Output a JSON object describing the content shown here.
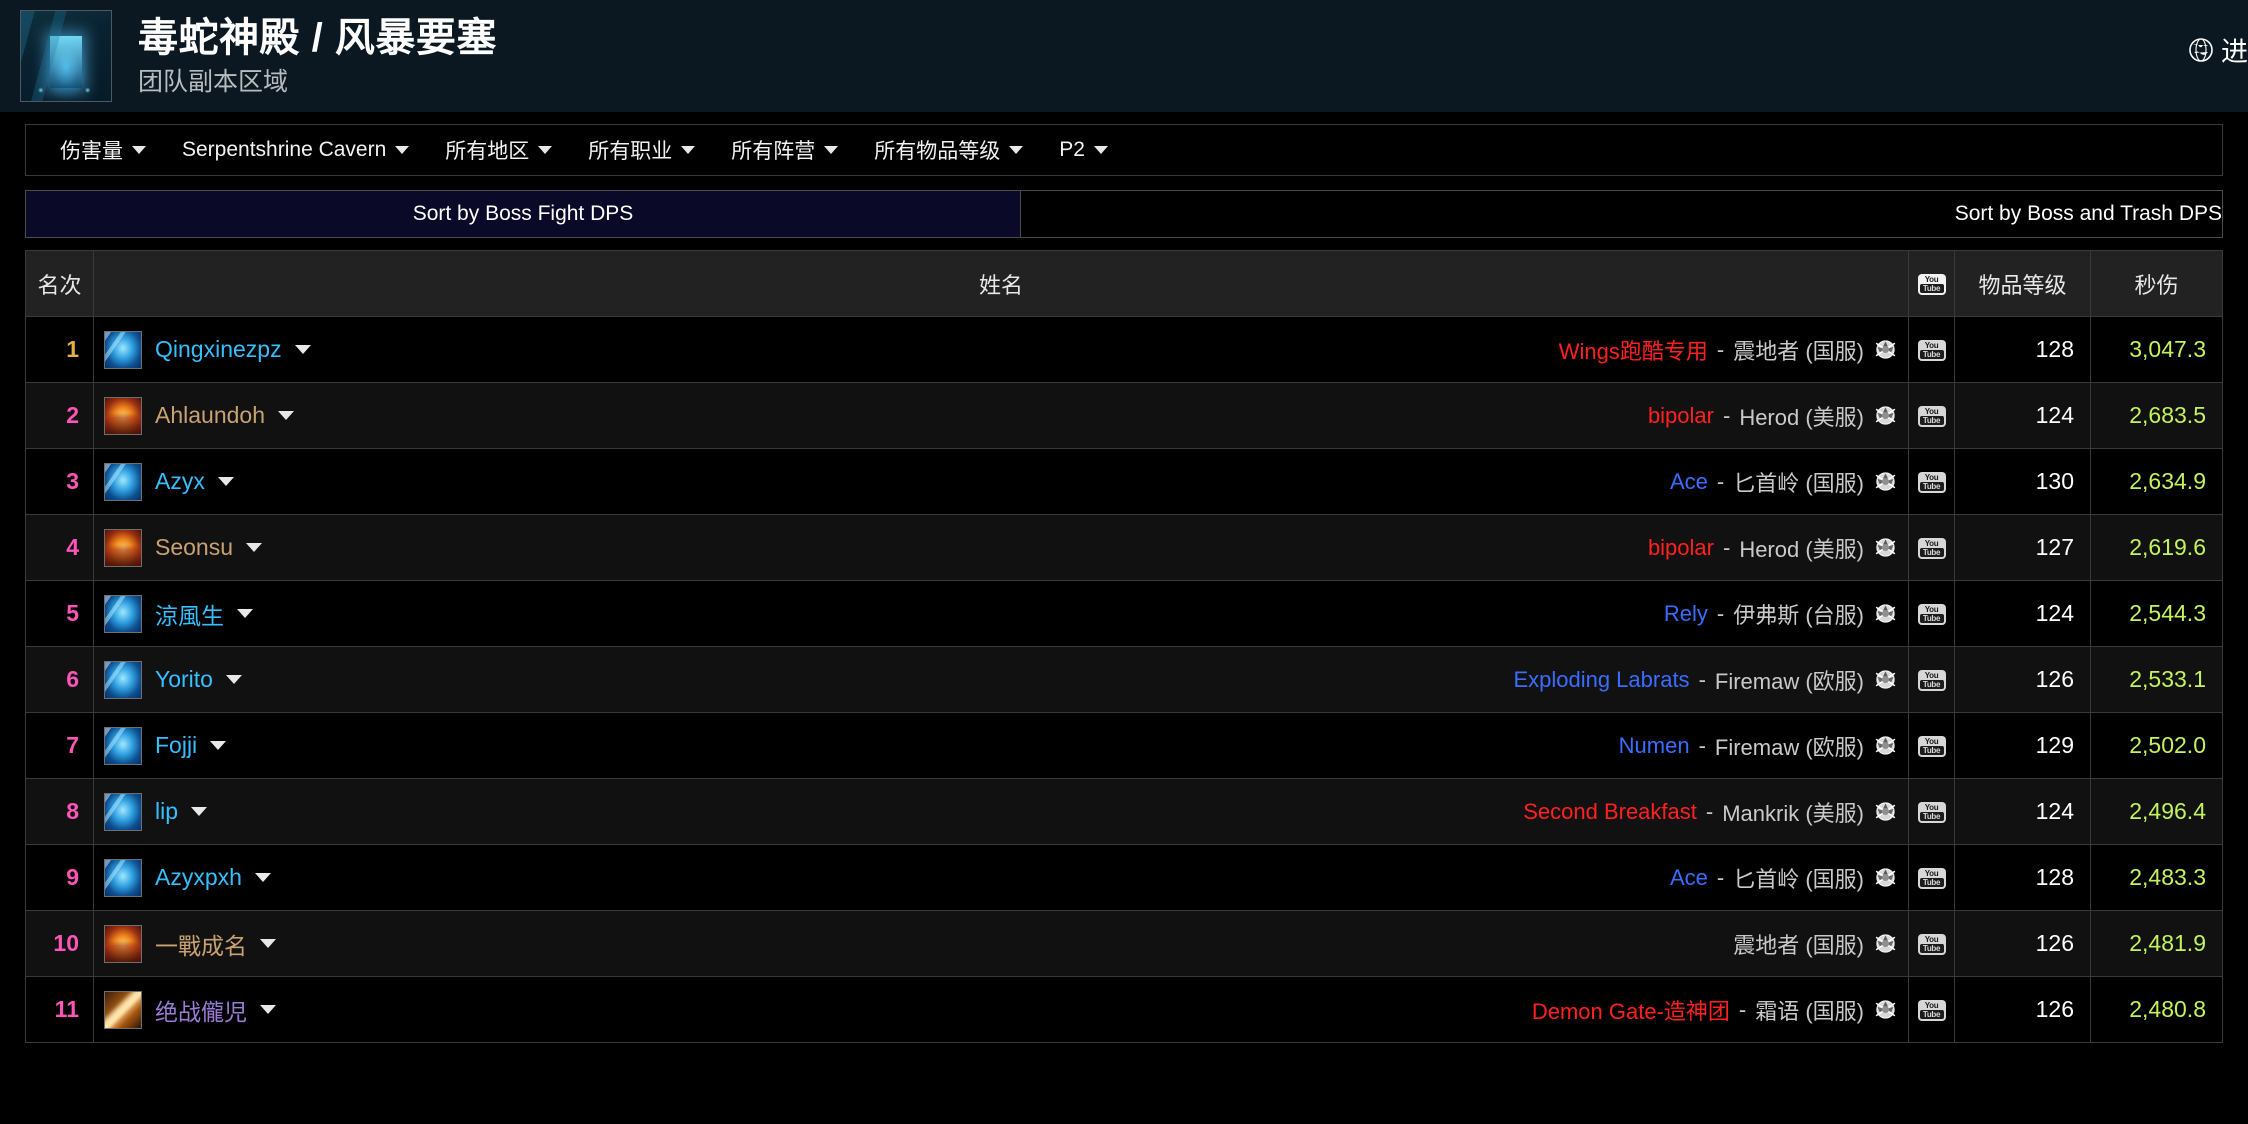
{
  "header": {
    "title": "毒蛇神殿 / 风暴要塞",
    "subtitle": "团队副本区域",
    "zone_icon": "raid-zone-icon",
    "language_label": "进",
    "language_icon": "globe-icon"
  },
  "filters": [
    {
      "label": "伤害量",
      "name": "metric"
    },
    {
      "label": "Serpentshrine Cavern",
      "name": "raid"
    },
    {
      "label": "所有地区",
      "name": "region"
    },
    {
      "label": "所有职业",
      "name": "class"
    },
    {
      "label": "所有阵营",
      "name": "faction"
    },
    {
      "label": "所有物品等级",
      "name": "item-level"
    },
    {
      "label": "P2",
      "name": "phase"
    }
  ],
  "sort_tabs": [
    {
      "label": "Sort by Boss Fight DPS",
      "active": true
    },
    {
      "label": "Sort by Boss and Trash DPS",
      "active": false
    }
  ],
  "table": {
    "columns": {
      "rank": "名次",
      "name": "姓名",
      "video": "youtube-icon",
      "item_level": "物品等级",
      "dps": "秒伤"
    },
    "rows": [
      {
        "rank": "1",
        "player": "Qingxinezpz",
        "player_color": "#36bfff",
        "class_icon": "icon-shaman",
        "guild": "Wings跑酷专用",
        "faction": "horde",
        "realm": "震地者 (国服)",
        "item_level": "128",
        "dps": "3,047.3"
      },
      {
        "rank": "2",
        "player": "Ahlaundoh",
        "player_color": "#c8a271",
        "class_icon": "icon-warrior",
        "guild": "bipolar",
        "faction": "horde",
        "realm": "Herod (美服)",
        "item_level": "124",
        "dps": "2,683.5"
      },
      {
        "rank": "3",
        "player": "Azyx",
        "player_color": "#36bfff",
        "class_icon": "icon-shaman",
        "guild": "Ace",
        "faction": "alliance",
        "realm": "匕首岭 (国服)",
        "item_level": "130",
        "dps": "2,634.9"
      },
      {
        "rank": "4",
        "player": "Seonsu",
        "player_color": "#c8a271",
        "class_icon": "icon-warrior",
        "guild": "bipolar",
        "faction": "horde",
        "realm": "Herod (美服)",
        "item_level": "127",
        "dps": "2,619.6"
      },
      {
        "rank": "5",
        "player": "涼風生",
        "player_color": "#36bfff",
        "class_icon": "icon-shaman",
        "guild": "Rely",
        "faction": "alliance",
        "realm": "伊弗斯 (台服)",
        "item_level": "124",
        "dps": "2,544.3"
      },
      {
        "rank": "6",
        "player": "Yorito",
        "player_color": "#36bfff",
        "class_icon": "icon-shaman",
        "guild": "Exploding Labrats",
        "faction": "alliance",
        "realm": "Firemaw (欧服)",
        "item_level": "126",
        "dps": "2,533.1"
      },
      {
        "rank": "7",
        "player": "Fojji",
        "player_color": "#36bfff",
        "class_icon": "icon-shaman",
        "guild": "Numen",
        "faction": "alliance",
        "realm": "Firemaw (欧服)",
        "item_level": "129",
        "dps": "2,502.0"
      },
      {
        "rank": "8",
        "player": "lip",
        "player_color": "#36bfff",
        "class_icon": "icon-shaman",
        "guild": "Second Breakfast",
        "faction": "horde",
        "realm": "Mankrik (美服)",
        "item_level": "124",
        "dps": "2,496.4"
      },
      {
        "rank": "9",
        "player": "Azyxpxh",
        "player_color": "#36bfff",
        "class_icon": "icon-shaman",
        "guild": "Ace",
        "faction": "alliance",
        "realm": "匕首岭 (国服)",
        "item_level": "128",
        "dps": "2,483.3"
      },
      {
        "rank": "10",
        "player": "一戰成名",
        "player_color": "#c8a271",
        "class_icon": "icon-warrior",
        "guild": "",
        "faction": "none",
        "realm": "震地者 (国服)",
        "item_level": "126",
        "dps": "2,481.9"
      },
      {
        "rank": "11",
        "player": "绝战儱児",
        "player_color": "#9b7bd4",
        "class_icon": "icon-warlock",
        "guild": "Demon Gate-造神团",
        "faction": "horde",
        "realm": "霜语 (国服)",
        "item_level": "126",
        "dps": "2,480.8"
      }
    ]
  },
  "colors": {
    "rank_top": "#e4b040",
    "rank_other": "#ff55b8",
    "dps_value": "#c4f25c",
    "horde": "#ff2020",
    "alliance": "#3a6dff",
    "header_bg": "#0b1822",
    "active_tab_bg": "#0a0a28"
  }
}
